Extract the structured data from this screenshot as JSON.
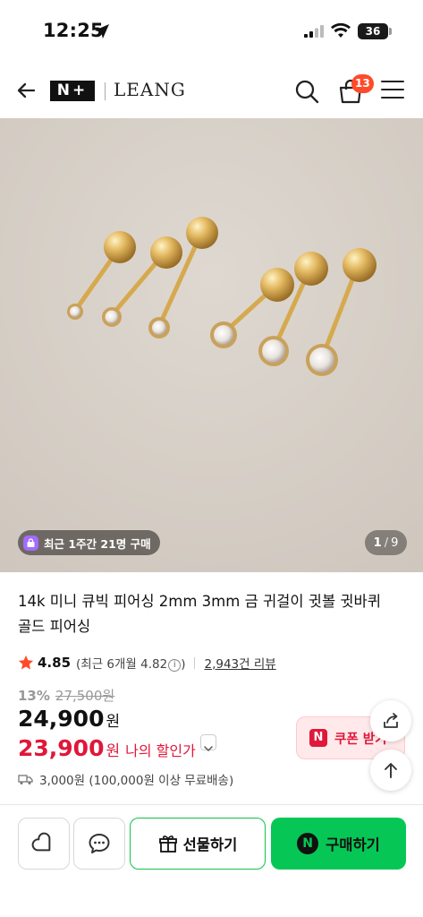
{
  "status_bar": {
    "time": "12:25",
    "battery": "36"
  },
  "header": {
    "brand_mark": "N+",
    "brand_name": "LEANG",
    "cart_count": "13"
  },
  "gallery": {
    "purchase_badge": "최근 1주간 21명 구매",
    "page_current": "1",
    "page_total": "9"
  },
  "product": {
    "title": "14k 미니 큐빅 피어싱 2mm 3mm 금 귀걸이 귓볼 귓바퀴 골드 피어싱",
    "rating": "4.85",
    "recent_rating_prefix": "(최근 6개월 4.82",
    "recent_rating_suffix": ")",
    "review_count": "2,943건 리뷰",
    "discount_rate": "13%",
    "original_price": "27,500원",
    "sale_price": "24,900",
    "currency": "원",
    "my_price": "23,900",
    "my_price_label": "나의 할인가",
    "coupon_label": "쿠폰 받기",
    "delivery": "3,000원 (100,000원 이상 무료배송)"
  },
  "bottom_bar": {
    "gift_label": "선물하기",
    "buy_label": "구매하기"
  },
  "colors": {
    "accent_green": "#06c755",
    "price_red": "#e0173a",
    "badge_orange": "#ff4a2a"
  }
}
